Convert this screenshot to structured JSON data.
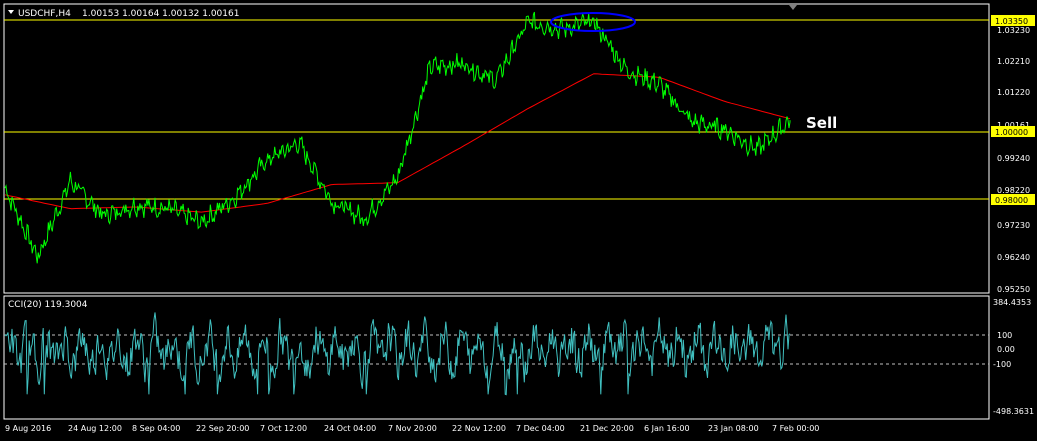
{
  "main": {
    "title": "USDCHF,H4",
    "ohlc": "1.00153 1.00164 1.00132 1.00161",
    "price_ticks": [
      "1.03230",
      "1.02210",
      "1.01220",
      "1.00161",
      "0.99240",
      "0.98220",
      "0.97230",
      "0.96240",
      "0.95250"
    ],
    "hline_labels": [
      "1.03350",
      "1.00000",
      "0.98000"
    ],
    "annotation": "Sell"
  },
  "indicator": {
    "title": "CCI(20) 119.3004",
    "ticks": [
      "384.4353",
      "100",
      "0.00",
      "-100",
      "-498.3631"
    ]
  },
  "time_axis": {
    "labels": [
      "9 Aug 2016",
      "24 Aug 12:00",
      "8 Sep 04:00",
      "22 Sep 20:00",
      "7 Oct 12:00",
      "24 Oct 04:00",
      "7 Nov 20:00",
      "22 Nov 12:00",
      "7 Dec 04:00",
      "21 Dec 20:00",
      "6 Jan 16:00",
      "23 Jan 08:00",
      "7 Feb 00:00"
    ]
  },
  "colors": {
    "background": "#000000",
    "price_line": "#00ff00",
    "moving_average": "#ff0000",
    "level_line": "#ffff00",
    "level_label_bg": "#ffff00",
    "cci_line": "#40c0c0",
    "ellipse": "#0000ff",
    "axis": "#ffffff"
  },
  "chart_data": {
    "type": "line",
    "symbol": "USDCHF",
    "timeframe": "H4",
    "ylim": [
      0.9525,
      1.034
    ],
    "series": [
      {
        "name": "",
        "x": [
          "9 Aug 2016",
          "15 Aug",
          "24 Aug 12:00",
          "31 Aug",
          "8 Sep 04:00",
          "15 Sep",
          "22 Sep 20:00",
          "30 Sep",
          "7 Oct 12:00",
          "15 Oct",
          "24 Oct 04:00",
          "31 Oct",
          "7 Nov 20:00",
          "14 Nov",
          "22 Nov 12:00",
          "30 Nov",
          "7 Dec 04:00",
          "14 Dec",
          "21 Dec 20:00",
          "29 Dec",
          "6 Jan 16:00",
          "15 Jan",
          "23 Jan 08:00",
          "31 Jan",
          "7 Feb 00:00"
        ],
        "values": [
          0.982,
          0.962,
          0.984,
          0.974,
          0.977,
          0.976,
          0.972,
          0.979,
          0.99,
          0.995,
          0.978,
          0.973,
          0.985,
          1.017,
          1.018,
          1.013,
          1.03,
          1.028,
          1.03,
          1.016,
          1.012,
          1.001,
          0.999,
          0.993,
          1.0016
        ]
      },
      {
        "name": "",
        "x": [
          "9 Aug 2016",
          "24 Aug 12:00",
          "8 Sep 04:00",
          "22 Sep 20:00",
          "7 Oct 12:00",
          "24 Oct 04:00",
          "7 Nov 20:00",
          "22 Nov 12:00",
          "7 Dec 04:00",
          "21 Dec 20:00",
          "6 Jan 16:00",
          "23 Jan 08:00",
          "7 Feb 00:00"
        ],
        "values": [
          0.98,
          0.976,
          0.9765,
          0.975,
          0.9775,
          0.983,
          0.9835,
          0.994,
          1.005,
          1.015,
          1.014,
          1.007,
          1.002
        ]
      }
    ],
    "horizontal_levels": [
      1.0335,
      1.0,
      0.98
    ],
    "cci": {
      "ylim": [
        -498.3631,
        384.4353
      ],
      "levels": [
        100,
        0,
        -100
      ],
      "last": 119.3004
    }
  }
}
